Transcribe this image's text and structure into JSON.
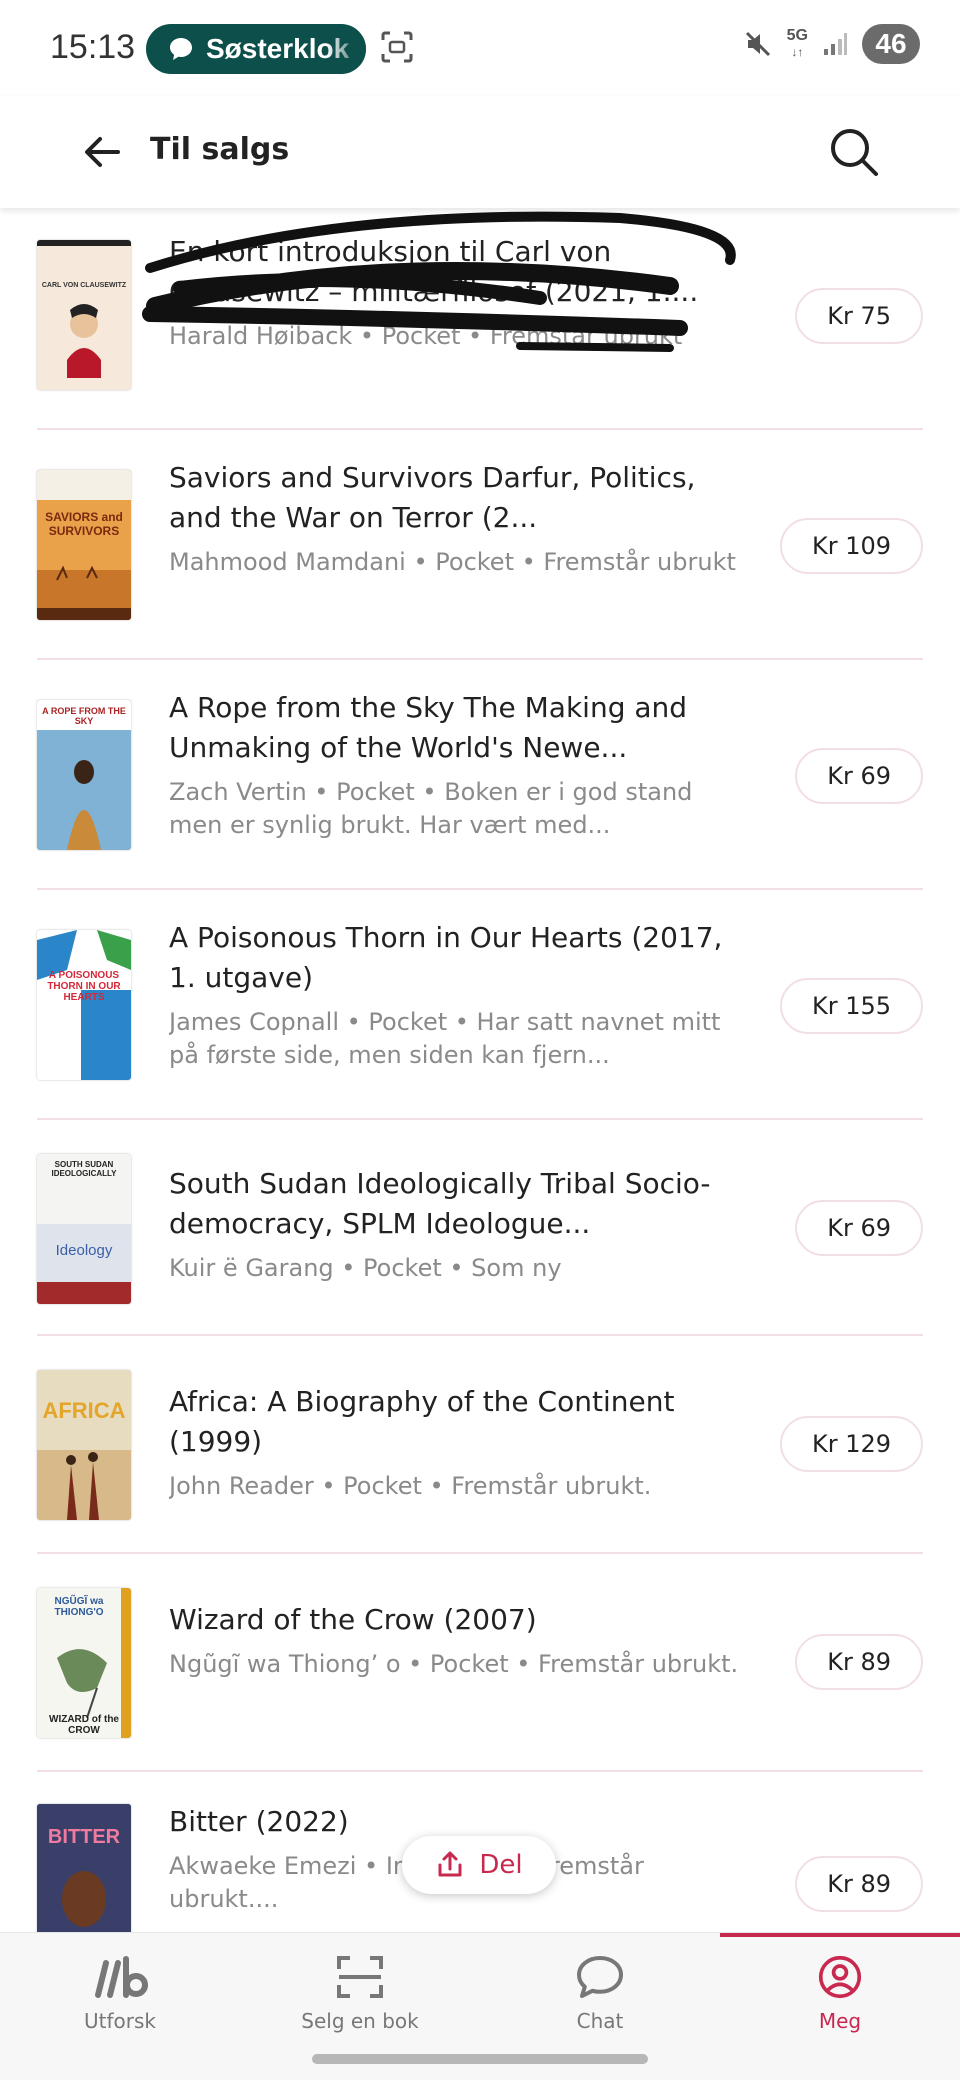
{
  "status_bar": {
    "time": "15:13",
    "notification_app": "Søsterklok",
    "network": "5G",
    "battery": "46"
  },
  "header": {
    "title": "Til salgs"
  },
  "books": [
    {
      "title": "En kort introduksjon til Carl von Clausewitz – militærfilosof (2021, 1....",
      "meta": "Harald Høiback • Pocket • Fremstår ubrukt",
      "price": "Kr 75",
      "cover": {
        "bg": "#f7e8dc",
        "label": "CARL VON CLAUSEWITZ",
        "accent": "#b8182a"
      }
    },
    {
      "title": "Saviors and Survivors Darfur, Politics, and the War on Terror (2...",
      "meta": "Mahmood Mamdani • Pocket • Fremstår ubrukt",
      "price": "Kr 109",
      "cover": {
        "bg": "#d98a2e",
        "label": "SAVIORS and SURVIVORS",
        "accent": "#8b3a12"
      }
    },
    {
      "title": "A Rope from the Sky The Making and Unmaking of the World's Newe...",
      "meta": "Zach Vertin • Pocket • Boken er i god stand men er synlig brukt. Har vært med...",
      "price": "Kr 69",
      "cover": {
        "bg": "#6fa4c9",
        "label": "A ROPE FROM THE SKY",
        "accent": "#c98a3a"
      }
    },
    {
      "title": "A Poisonous Thorn in Our Hearts (2017, 1. utgave)",
      "meta": "James Copnall • Pocket • Har satt navnet mitt på første side, men siden kan fjern...",
      "price": "Kr 155",
      "cover": {
        "bg": "#ffffff",
        "label": "A POISONOUS THORN IN OUR HEARTS",
        "accent": "#d4283a"
      }
    },
    {
      "title": "South Sudan Ideologically Tribal Socio-democracy, SPLM Ideologue...",
      "meta": "Kuir ë Garang • Pocket • Som ny",
      "price": "Kr 69",
      "cover": {
        "bg": "#f4f4f2",
        "label": "SOUTH SUDAN IDEOLOGICALLY",
        "accent": "#a22a2a"
      }
    },
    {
      "title": "Africa: A Biography of the Continent (1999)",
      "meta": "John Reader • Pocket • Fremstår ubrukt.",
      "price": "Kr 129",
      "cover": {
        "bg": "#e8dcc0",
        "label": "AFRICA",
        "accent": "#e3a52a"
      }
    },
    {
      "title": "Wizard of the Crow (2007)",
      "meta": "Ngũgĩ wa Thiong’ o • Pocket • Fremstår ubrukt.",
      "price": "Kr 89",
      "cover": {
        "bg": "#f6f6f0",
        "label": "NGŨGĨ wa THIONG'O",
        "accent": "#2c8a3a"
      }
    },
    {
      "title": "Bitter (2022)",
      "meta": "Akwaeke Emezi • Innbundet • Fremstår ubrukt....",
      "price": "Kr 89",
      "cover": {
        "bg": "#3a3f6a",
        "label": "BITTER",
        "accent": "#e05a8a"
      }
    }
  ],
  "share": {
    "label": "Del"
  },
  "nav": [
    {
      "label": "Utforsk",
      "icon": "logo-icon"
    },
    {
      "label": "Selg en bok",
      "icon": "scan-icon"
    },
    {
      "label": "Chat",
      "icon": "chat-icon"
    },
    {
      "label": "Meg",
      "icon": "profile-icon"
    }
  ],
  "colors": {
    "accent": "#c8294f",
    "pill": "#0d4f4a"
  }
}
